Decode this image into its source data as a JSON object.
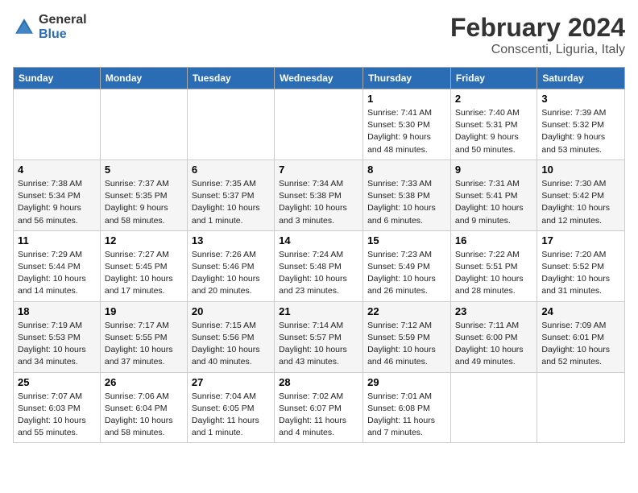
{
  "logo": {
    "line1": "General",
    "line2": "Blue"
  },
  "title": "February 2024",
  "subtitle": "Conscenti, Liguria, Italy",
  "days_header": [
    "Sunday",
    "Monday",
    "Tuesday",
    "Wednesday",
    "Thursday",
    "Friday",
    "Saturday"
  ],
  "weeks": [
    [
      {
        "day": "",
        "info": ""
      },
      {
        "day": "",
        "info": ""
      },
      {
        "day": "",
        "info": ""
      },
      {
        "day": "",
        "info": ""
      },
      {
        "day": "1",
        "info": "Sunrise: 7:41 AM\nSunset: 5:30 PM\nDaylight: 9 hours\nand 48 minutes."
      },
      {
        "day": "2",
        "info": "Sunrise: 7:40 AM\nSunset: 5:31 PM\nDaylight: 9 hours\nand 50 minutes."
      },
      {
        "day": "3",
        "info": "Sunrise: 7:39 AM\nSunset: 5:32 PM\nDaylight: 9 hours\nand 53 minutes."
      }
    ],
    [
      {
        "day": "4",
        "info": "Sunrise: 7:38 AM\nSunset: 5:34 PM\nDaylight: 9 hours\nand 56 minutes."
      },
      {
        "day": "5",
        "info": "Sunrise: 7:37 AM\nSunset: 5:35 PM\nDaylight: 9 hours\nand 58 minutes."
      },
      {
        "day": "6",
        "info": "Sunrise: 7:35 AM\nSunset: 5:37 PM\nDaylight: 10 hours\nand 1 minute."
      },
      {
        "day": "7",
        "info": "Sunrise: 7:34 AM\nSunset: 5:38 PM\nDaylight: 10 hours\nand 3 minutes."
      },
      {
        "day": "8",
        "info": "Sunrise: 7:33 AM\nSunset: 5:38 PM\nDaylight: 10 hours\nand 6 minutes."
      },
      {
        "day": "9",
        "info": "Sunrise: 7:31 AM\nSunset: 5:41 PM\nDaylight: 10 hours\nand 9 minutes."
      },
      {
        "day": "10",
        "info": "Sunrise: 7:30 AM\nSunset: 5:42 PM\nDaylight: 10 hours\nand 12 minutes."
      }
    ],
    [
      {
        "day": "11",
        "info": "Sunrise: 7:29 AM\nSunset: 5:44 PM\nDaylight: 10 hours\nand 14 minutes."
      },
      {
        "day": "12",
        "info": "Sunrise: 7:27 AM\nSunset: 5:45 PM\nDaylight: 10 hours\nand 17 minutes."
      },
      {
        "day": "13",
        "info": "Sunrise: 7:26 AM\nSunset: 5:46 PM\nDaylight: 10 hours\nand 20 minutes."
      },
      {
        "day": "14",
        "info": "Sunrise: 7:24 AM\nSunset: 5:48 PM\nDaylight: 10 hours\nand 23 minutes."
      },
      {
        "day": "15",
        "info": "Sunrise: 7:23 AM\nSunset: 5:49 PM\nDaylight: 10 hours\nand 26 minutes."
      },
      {
        "day": "16",
        "info": "Sunrise: 7:22 AM\nSunset: 5:51 PM\nDaylight: 10 hours\nand 28 minutes."
      },
      {
        "day": "17",
        "info": "Sunrise: 7:20 AM\nSunset: 5:52 PM\nDaylight: 10 hours\nand 31 minutes."
      }
    ],
    [
      {
        "day": "18",
        "info": "Sunrise: 7:19 AM\nSunset: 5:53 PM\nDaylight: 10 hours\nand 34 minutes."
      },
      {
        "day": "19",
        "info": "Sunrise: 7:17 AM\nSunset: 5:55 PM\nDaylight: 10 hours\nand 37 minutes."
      },
      {
        "day": "20",
        "info": "Sunrise: 7:15 AM\nSunset: 5:56 PM\nDaylight: 10 hours\nand 40 minutes."
      },
      {
        "day": "21",
        "info": "Sunrise: 7:14 AM\nSunset: 5:57 PM\nDaylight: 10 hours\nand 43 minutes."
      },
      {
        "day": "22",
        "info": "Sunrise: 7:12 AM\nSunset: 5:59 PM\nDaylight: 10 hours\nand 46 minutes."
      },
      {
        "day": "23",
        "info": "Sunrise: 7:11 AM\nSunset: 6:00 PM\nDaylight: 10 hours\nand 49 minutes."
      },
      {
        "day": "24",
        "info": "Sunrise: 7:09 AM\nSunset: 6:01 PM\nDaylight: 10 hours\nand 52 minutes."
      }
    ],
    [
      {
        "day": "25",
        "info": "Sunrise: 7:07 AM\nSunset: 6:03 PM\nDaylight: 10 hours\nand 55 minutes."
      },
      {
        "day": "26",
        "info": "Sunrise: 7:06 AM\nSunset: 6:04 PM\nDaylight: 10 hours\nand 58 minutes."
      },
      {
        "day": "27",
        "info": "Sunrise: 7:04 AM\nSunset: 6:05 PM\nDaylight: 11 hours\nand 1 minute."
      },
      {
        "day": "28",
        "info": "Sunrise: 7:02 AM\nSunset: 6:07 PM\nDaylight: 11 hours\nand 4 minutes."
      },
      {
        "day": "29",
        "info": "Sunrise: 7:01 AM\nSunset: 6:08 PM\nDaylight: 11 hours\nand 7 minutes."
      },
      {
        "day": "",
        "info": ""
      },
      {
        "day": "",
        "info": ""
      }
    ]
  ]
}
